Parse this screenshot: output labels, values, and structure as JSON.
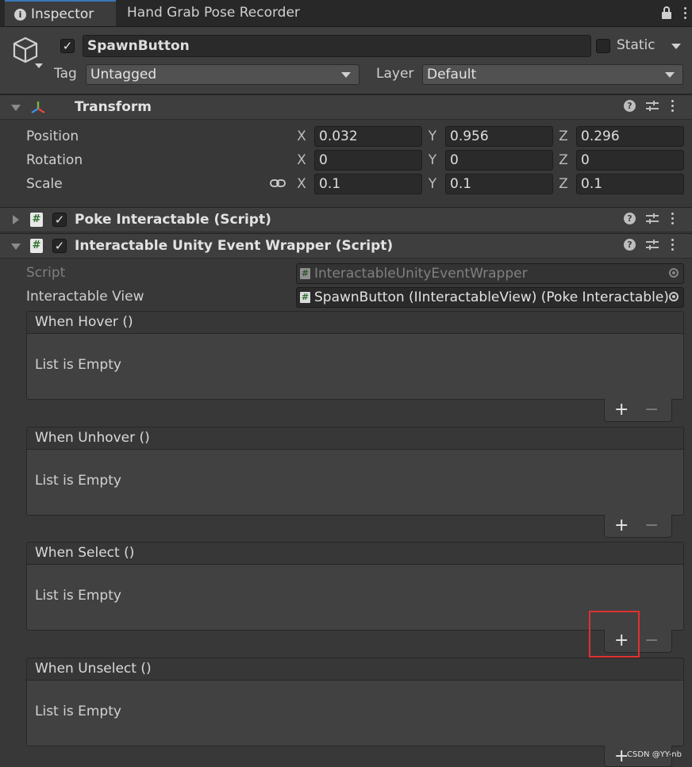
{
  "tabs": {
    "inspector": "Inspector",
    "hand_grab": "Hand Grab Pose Recorder"
  },
  "gameobject": {
    "name": "SpawnButton",
    "static_label": "Static",
    "tag_label": "Tag",
    "tag_value": "Untagged",
    "layer_label": "Layer",
    "layer_value": "Default"
  },
  "transform": {
    "title": "Transform",
    "position_label": "Position",
    "rotation_label": "Rotation",
    "scale_label": "Scale",
    "axes": {
      "x": "X",
      "y": "Y",
      "z": "Z"
    },
    "position": {
      "x": "0.032",
      "y": "0.956",
      "z": "0.296"
    },
    "rotation": {
      "x": "0",
      "y": "0",
      "z": "0"
    },
    "scale": {
      "x": "0.1",
      "y": "0.1",
      "z": "0.1"
    }
  },
  "components": {
    "poke": {
      "title": "Poke Interactable (Script)"
    },
    "wrapper": {
      "title": "Interactable Unity Event Wrapper (Script)",
      "script_label": "Script",
      "script_value": "InteractableUnityEventWrapper",
      "view_label": "Interactable View",
      "view_value": "SpawnButton (IInteractableView) (Poke Interactable)"
    }
  },
  "events": [
    {
      "title": "When Hover ()",
      "empty_text": "List is Empty"
    },
    {
      "title": "When Unhover ()",
      "empty_text": "List is Empty"
    },
    {
      "title": "When Select ()",
      "empty_text": "List is Empty"
    },
    {
      "title": "When Unselect ()",
      "empty_text": "List is Empty"
    }
  ],
  "list_controls": {
    "add": "+",
    "remove": "−"
  },
  "header_icons": {
    "help": "?",
    "script": "#"
  },
  "watermark": "CSDN @YY-nb",
  "highlight_color": "#e03030",
  "accent_color": "#3a79bb"
}
